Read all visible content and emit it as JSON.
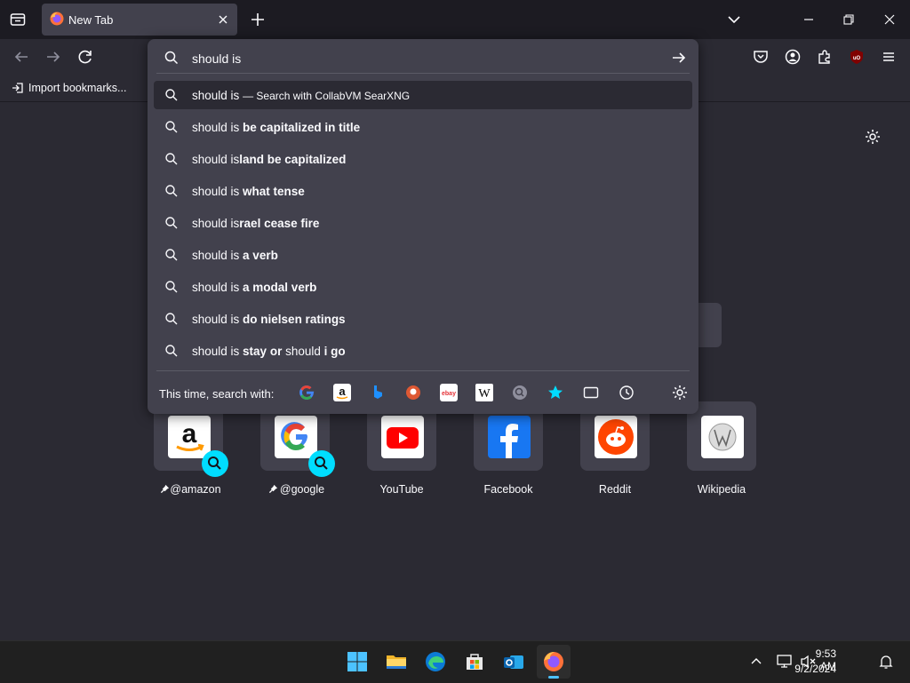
{
  "tab": {
    "title": "New Tab"
  },
  "bookmarks": {
    "import_label": "Import bookmarks..."
  },
  "urlbar": {
    "value": "should is"
  },
  "suggestions": [
    {
      "prefix": "should is",
      "suffix": "",
      "hint": "— Search with CollabVM SearXNG",
      "selected": true
    },
    {
      "prefix": "should is",
      "suffix": " be capitalized in title"
    },
    {
      "prefix": "should is",
      "suffix": "land be capitalized"
    },
    {
      "prefix": "should is",
      "suffix": " what tense"
    },
    {
      "prefix": "should is",
      "suffix": "rael cease fire"
    },
    {
      "prefix": "should is",
      "suffix": " a verb"
    },
    {
      "prefix": "should is",
      "suffix": " a modal verb"
    },
    {
      "prefix": "should is",
      "suffix": " do nielsen ratings"
    },
    {
      "prefix": "should is",
      "suffix": " stay or",
      "mid": " should ",
      "tail": "i go"
    }
  ],
  "oneoff": {
    "label": "This time, search with:",
    "engines": [
      "google-icon",
      "amazon-icon",
      "bing-icon",
      "duckduckgo-icon",
      "ebay-icon",
      "wikipedia-icon",
      "searxng-icon",
      "bookmarks-icon",
      "tabs-icon",
      "history-icon",
      "search-settings-icon"
    ]
  },
  "shortcuts": [
    {
      "label": "@amazon",
      "pinned": true,
      "search": true
    },
    {
      "label": "@google",
      "pinned": true,
      "search": true
    },
    {
      "label": "YouTube"
    },
    {
      "label": "Facebook"
    },
    {
      "label": "Reddit"
    },
    {
      "label": "Wikipedia"
    }
  ],
  "taskbar": {
    "time": "9:53 AM",
    "date": "9/2/2024"
  },
  "colors": {
    "accent": "#00ddff",
    "firefox_orange": "#ff7139",
    "youtube_red": "#ff0000",
    "reddit": "#ff4500",
    "facebook": "#1877f2"
  }
}
